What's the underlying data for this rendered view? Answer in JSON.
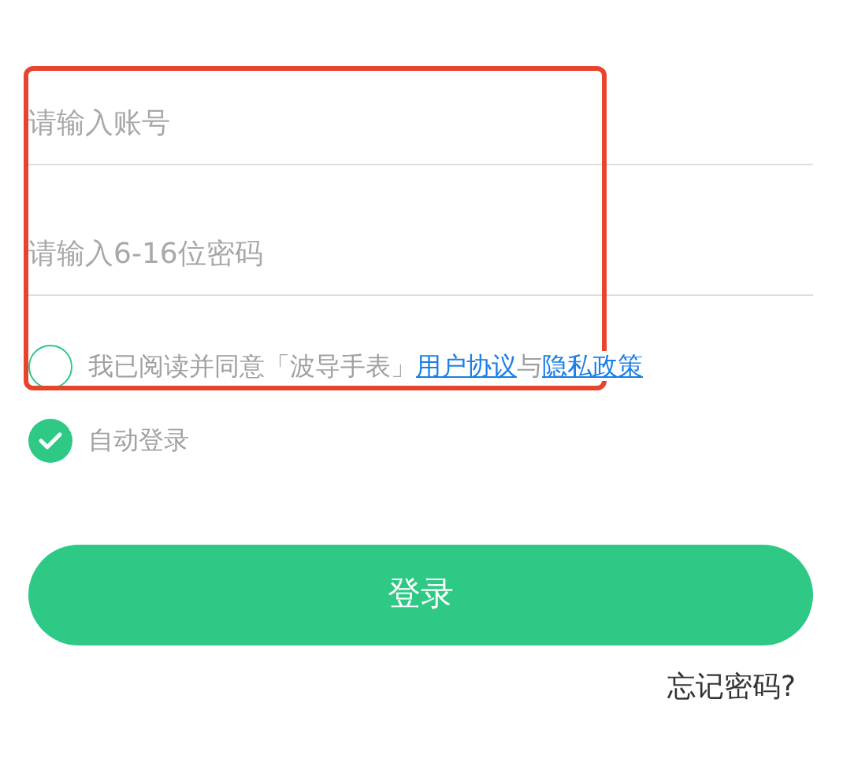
{
  "account_field": {
    "placeholder": "请输入账号"
  },
  "password_field": {
    "placeholder": "请输入6-16位密码"
  },
  "agreement": {
    "checked": false,
    "text": "我已阅读并同意「波导手表」",
    "links": [
      "用户协议",
      "隐私政策"
    ],
    "joiner": "与"
  },
  "auto_login": {
    "checked": true,
    "label": "自动登录"
  },
  "login_button": "登录",
  "forgot_password": "忘记密码?",
  "annotation": {
    "kind": "highlight",
    "color": "#e8432d"
  }
}
